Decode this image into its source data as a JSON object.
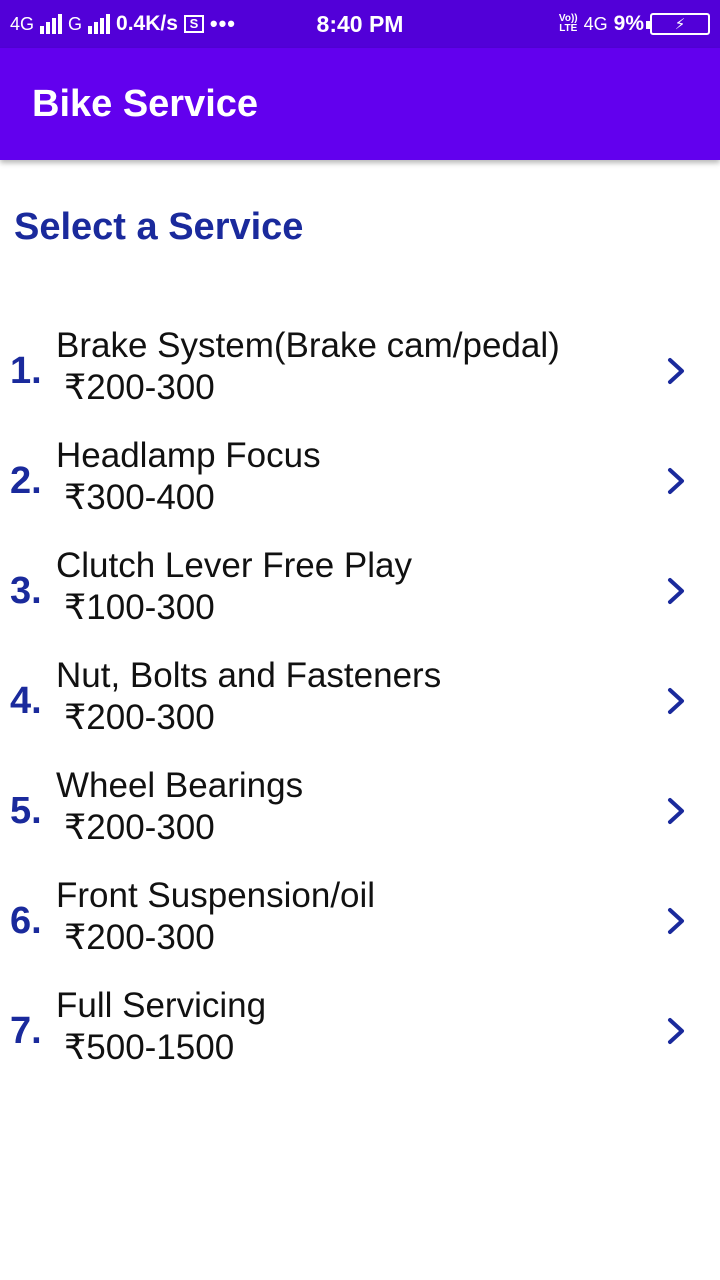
{
  "status_bar": {
    "network1": "4G",
    "network2": "G",
    "speed": "0.4K/s",
    "screen_icon_text": "S",
    "more": "•••",
    "time": "8:40 PM",
    "volte_top": "Vo))",
    "volte_bottom": "LTE",
    "network3": "4G",
    "battery_text": "9%",
    "icons": [
      "signal-icon",
      "signal-icon",
      "screenshot-icon",
      "more-icon",
      "volte-icon",
      "battery-charging-icon"
    ]
  },
  "app_bar": {
    "title": "Bike Service"
  },
  "main": {
    "section_title": "Select a Service",
    "services": [
      {
        "number": "1.",
        "name": "Brake System(Brake cam/pedal)",
        "price": "₹200-300"
      },
      {
        "number": "2.",
        "name": "Headlamp Focus",
        "price": "₹300-400"
      },
      {
        "number": "3.",
        "name": "Clutch Lever Free Play",
        "price": "₹100-300"
      },
      {
        "number": "4.",
        "name": "Nut, Bolts and Fasteners",
        "price": "₹200-300"
      },
      {
        "number": "5.",
        "name": "Wheel Bearings",
        "price": "₹200-300"
      },
      {
        "number": "6.",
        "name": "Front Suspension/oil",
        "price": "₹200-300"
      },
      {
        "number": "7.",
        "name": "Full Servicing",
        "price": "₹500-1500"
      }
    ]
  },
  "colors": {
    "status_bar": "#5200d8",
    "app_bar": "#6200ee",
    "accent_text": "#1a2a9c",
    "body_text": "#111111"
  }
}
